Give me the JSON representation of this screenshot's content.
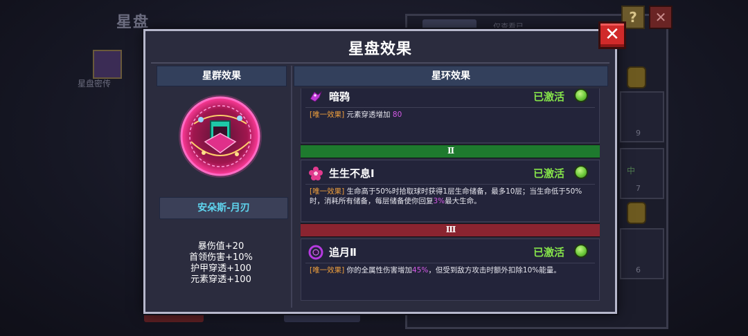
{
  "background": {
    "page_title": "星盘",
    "side_item_label": "星盘密传",
    "bg_tab_label": "仅查看已",
    "bg_help_icon": "?",
    "bg_close_icon": "✕",
    "bg_card_counts": [
      "9",
      "7",
      "6"
    ],
    "bg_card_text": "中"
  },
  "modal": {
    "title": "星盘效果",
    "close_icon": "✕"
  },
  "left": {
    "header": "星群效果",
    "emblem_icon": "constellation-emblem-icon",
    "hero_name": "安朵斯-月刃",
    "stats": [
      "暴伤值+20",
      "首领伤害+10%",
      "护甲穿透+100",
      "元素穿透+100"
    ]
  },
  "right": {
    "header": "星环效果",
    "effects": [
      {
        "name": "暗鸦",
        "icon": "raven-icon",
        "status": "已激活",
        "tag": "[唯一效果]",
        "desc_a": "元素穿透增加 ",
        "desc_hl": "80",
        "desc_b": ""
      },
      {
        "name": "生生不息Ⅰ",
        "icon": "flower-icon",
        "status": "已激活",
        "tag": "[唯一效果]",
        "desc_a": "生命高于50%时拾取球时获得1层生命储备，最多10层；当生命低于50%时，消耗所有储备，每层储备使你回复",
        "desc_hl": "3%",
        "desc_b": "最大生命。"
      },
      {
        "name": "追月Ⅱ",
        "icon": "moon-ring-icon",
        "status": "已激活",
        "tag": "[唯一效果]",
        "desc_a": "你的全属性伤害增加",
        "desc_hl": "45%",
        "desc_b": "，但受到敌方攻击时额外扣除10%能量。"
      }
    ],
    "tiers": [
      "Ⅱ",
      "Ⅲ"
    ]
  },
  "colors": {
    "tier_2": "#1e7a2e",
    "tier_3": "#8a2430",
    "active_green": "#86e44a",
    "tag_orange": "#f0a03c",
    "highlight_purple": "#d65ae8",
    "hero_name_cyan": "#5fd6f0"
  }
}
